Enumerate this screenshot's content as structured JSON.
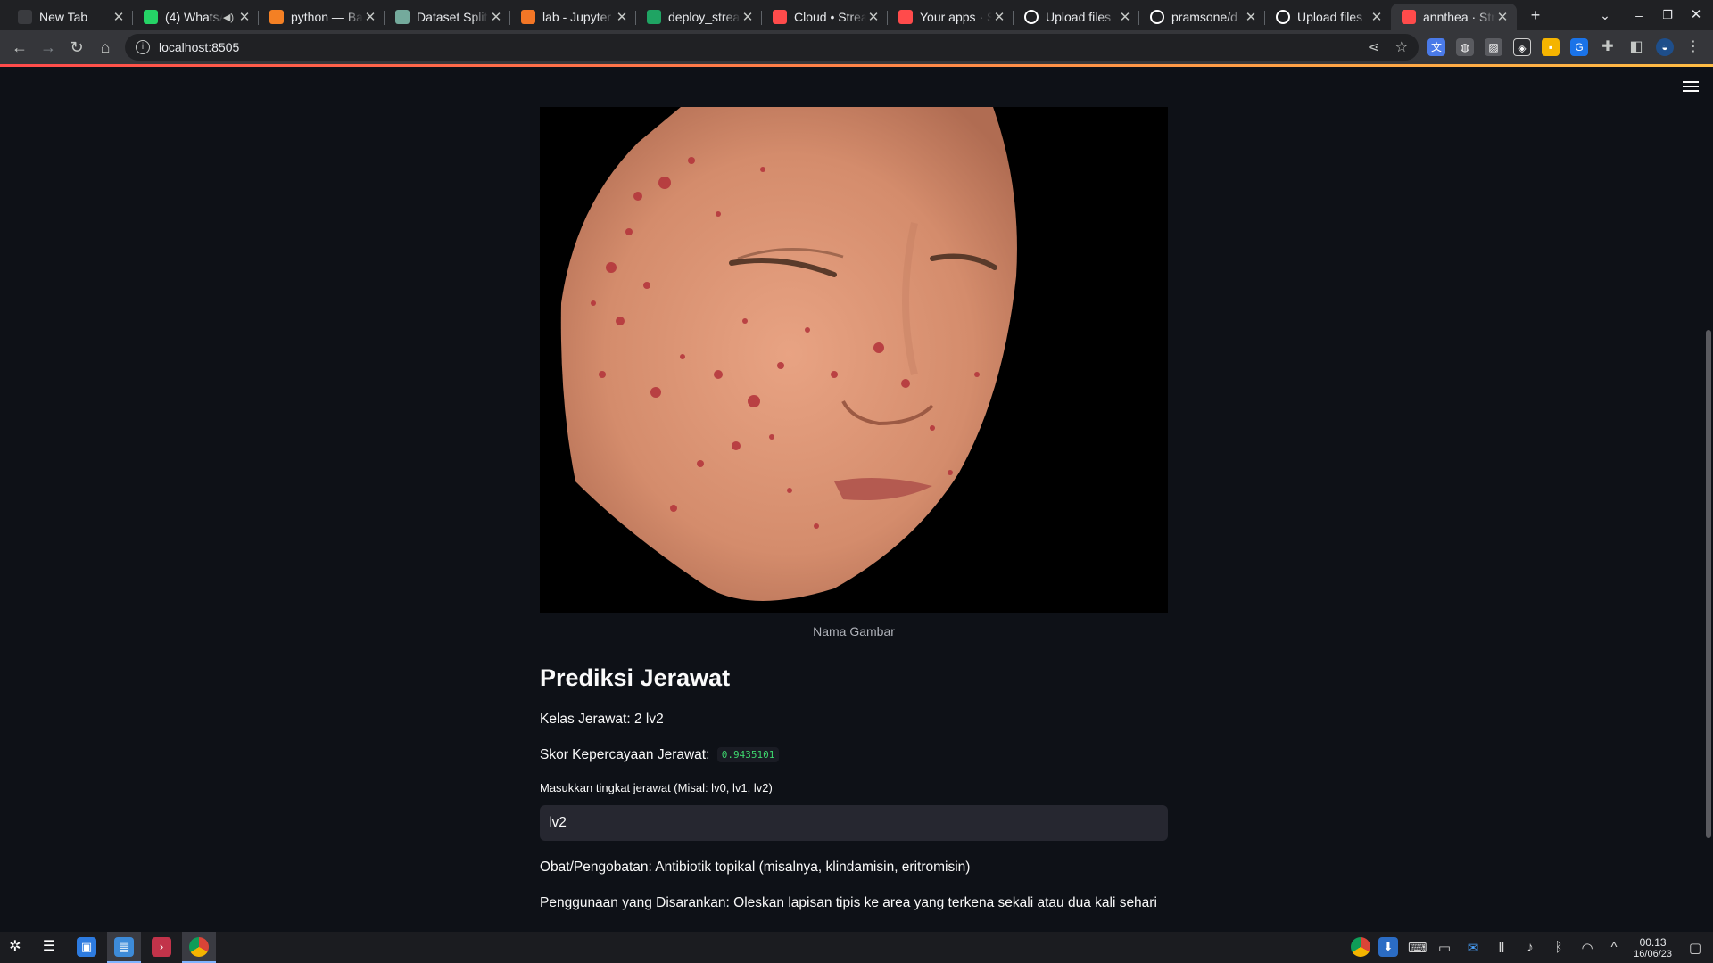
{
  "browser": {
    "tabs": [
      {
        "title": "New Tab",
        "icon": "chrome-icon",
        "color": "#3a3b3f"
      },
      {
        "title": "(4) WhatsApp",
        "icon": "whatsapp-icon",
        "color": "#25d366"
      },
      {
        "title": "python — Ba",
        "icon": "stackoverflow-icon",
        "color": "#f48024"
      },
      {
        "title": "Dataset Split",
        "icon": "openai-icon",
        "color": "#74aa9c"
      },
      {
        "title": "lab - Jupyter",
        "icon": "jupyter-icon",
        "color": "#f37626"
      },
      {
        "title": "deploy_strea",
        "icon": "google-drive-icon",
        "color": "#1fa463"
      },
      {
        "title": "Cloud • Strea",
        "icon": "streamlit-icon",
        "color": "#ff4b4b"
      },
      {
        "title": "Your apps · S",
        "icon": "streamlit-icon",
        "color": "#ff4b4b"
      },
      {
        "title": "Upload files",
        "icon": "github-icon",
        "color": "#ffffff"
      },
      {
        "title": "pramsone/d",
        "icon": "github-icon",
        "color": "#ffffff"
      },
      {
        "title": "Upload files",
        "icon": "github-icon",
        "color": "#ffffff"
      },
      {
        "title": "annthea · Str",
        "icon": "streamlit-icon",
        "color": "#ff4b4b"
      }
    ],
    "url": "localhost:8505"
  },
  "app": {
    "image_caption": "Nama Gambar",
    "heading": "Prediksi Jerawat",
    "class_text": "Kelas Jerawat: 2 lv2",
    "score_label": "Skor Kepercayaan Jerawat:",
    "score_value": "0.9435101",
    "input_label": "Masukkan tingkat jerawat (Misal: lv0, lv1, lv2)",
    "input_value": "lv2",
    "medication_text": "Obat/Pengobatan: Antibiotik topikal (misalnya, klindamisin, eritromisin)",
    "usage_text": "Penggunaan yang Disarankan: Oleskan lapisan tipis ke area yang terkena sekali atau dua kali sehari"
  },
  "taskbar": {
    "time": "00.13",
    "date": "16/06/23"
  }
}
